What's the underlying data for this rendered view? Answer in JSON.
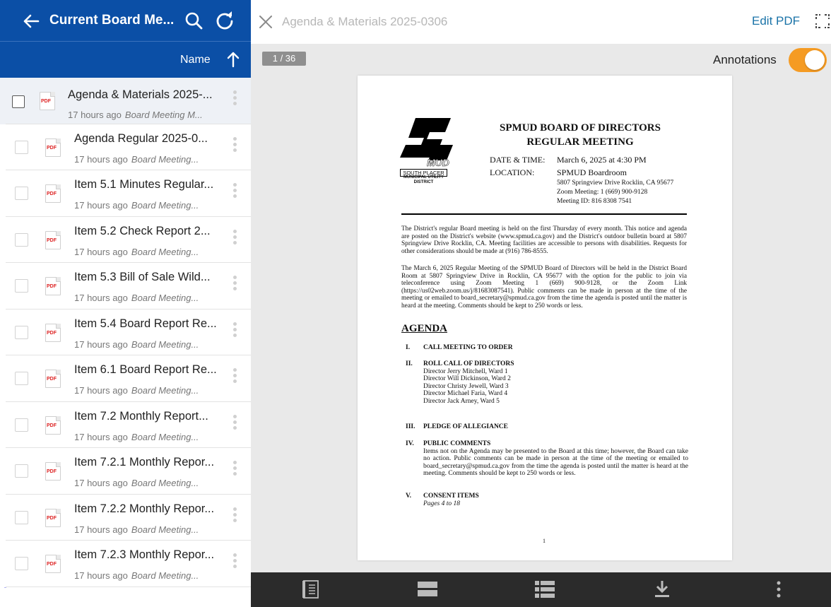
{
  "colors": {
    "header_blue": "#0b4fa6",
    "accent_orange": "#f59b23",
    "link_blue": "#1a73a8",
    "toolbar_dark": "#2b2b2b"
  },
  "left_pane": {
    "folder_title": "Current Board Me...",
    "sort_label": "Name",
    "icons": [
      "back-arrow-icon",
      "search-icon",
      "refresh-icon",
      "sort-ascending-icon"
    ],
    "files": [
      {
        "name": "Agenda & Materials 2025-...",
        "age": "17 hours ago",
        "folder": "Board Meeting M...",
        "selected": true
      },
      {
        "name": "Agenda Regular 2025-0...",
        "age": "17 hours ago",
        "folder": "Board Meeting...",
        "selected": false
      },
      {
        "name": "Item 5.1 Minutes Regular...",
        "age": "17 hours ago",
        "folder": "Board Meeting...",
        "selected": false
      },
      {
        "name": "Item 5.2 Check Report 2...",
        "age": "17 hours ago",
        "folder": "Board Meeting...",
        "selected": false
      },
      {
        "name": "Item 5.3 Bill of Sale Wild...",
        "age": "17 hours ago",
        "folder": "Board Meeting...",
        "selected": false
      },
      {
        "name": "Item 5.4 Board Report Re...",
        "age": "17 hours ago",
        "folder": "Board Meeting...",
        "selected": false
      },
      {
        "name": "Item 6.1 Board Report Re...",
        "age": "17 hours ago",
        "folder": "Board Meeting...",
        "selected": false
      },
      {
        "name": "Item 7.2 Monthly Report...",
        "age": "17 hours ago",
        "folder": "Board Meeting...",
        "selected": false
      },
      {
        "name": "Item 7.2.1 Monthly Repor...",
        "age": "17 hours ago",
        "folder": "Board Meeting...",
        "selected": false
      },
      {
        "name": "Item 7.2.2 Monthly Repor...",
        "age": "17 hours ago",
        "folder": "Board Meeting...",
        "selected": false
      },
      {
        "name": "Item 7.2.3 Monthly Repor...",
        "age": "17 hours ago",
        "folder": "Board Meeting...",
        "selected": false
      }
    ],
    "file_icon_tag": "PDF"
  },
  "viewer": {
    "doc_title": "Agenda & Materials 2025-0306",
    "edit_label": "Edit PDF",
    "page_indicator": "1 / 36",
    "annotations_label": "Annotations",
    "annotations_on": true,
    "bottom_toolbar_icons": [
      "outline-icon",
      "page-view-icon",
      "list-view-icon",
      "download-icon",
      "more-vertical-icon"
    ]
  },
  "pdf_page": {
    "logo_line1": "SOUTH PLACER",
    "logo_line2": "MUNICIPAL UTILITY DISTRICT",
    "title_line1": "SPMUD BOARD OF DIRECTORS",
    "title_line2": "REGULAR MEETING",
    "date_label": "DATE & TIME:",
    "date_value": "March 6, 2025 at 4:30 PM",
    "location_label": "LOCATION:",
    "location_value": "SPMUD Boardroom",
    "address_line1": "5807 Springview Drive Rocklin, CA 95677",
    "address_line2": "Zoom Meeting: 1 (669) 900-9128",
    "address_line3": "Meeting ID: 816 8308 7541",
    "para1": "The District's regular Board meeting is held on the first Thursday of every month. This notice and agenda are posted on the District's website (www.spmud.ca.gov) and the District's outdoor bulletin board at 5807 Springview Drive Rocklin, CA. Meeting facilities are accessible to persons with disabilities. Requests for other considerations should be made at (916) 786-8555.",
    "para2": "The March 6, 2025 Regular Meeting of the SPMUD Board of Directors will be held in the District Board Room at 5807 Springview Drive in Rocklin, CA 95677 with the option for the public to join via teleconference using Zoom Meeting 1 (669) 900-9128, or the Zoom Link (https://us02web.zoom.us/j/81683087541). Public comments can be made in person at the time of the meeting or emailed to board_secretary@spmud.ca.gov from the time the agenda is posted until the matter is heard at the meeting. Comments should be kept to 250 words or less.",
    "agenda_heading": "AGENDA",
    "items": [
      {
        "num": "I.",
        "title": "CALL MEETING TO ORDER"
      },
      {
        "num": "II.",
        "title": "ROLL CALL OF DIRECTORS",
        "lines": [
          "Director Jerry Mitchell, Ward 1",
          "Director Will Dickinson, Ward 2",
          "Director Christy Jewell, Ward 3",
          "Director Michael Faria, Ward 4",
          "Director Jack Arney, Ward 5"
        ]
      },
      {
        "num": "III.",
        "title": "PLEDGE OF ALLEGIANCE"
      },
      {
        "num": "IV.",
        "title": "PUBLIC COMMENTS",
        "body": "Items not on the Agenda may be presented to the Board at this time; however, the Board can take no action. Public comments can be made in person at the time of the meeting or emailed to board_secretary@spmud.ca.gov from the time the agenda is posted until the matter is heard at the meeting. Comments should be kept to 250 words or less."
      },
      {
        "num": "V.",
        "title": "CONSENT ITEMS",
        "note": "Pages 4 to 18"
      }
    ],
    "page_number": "1"
  }
}
